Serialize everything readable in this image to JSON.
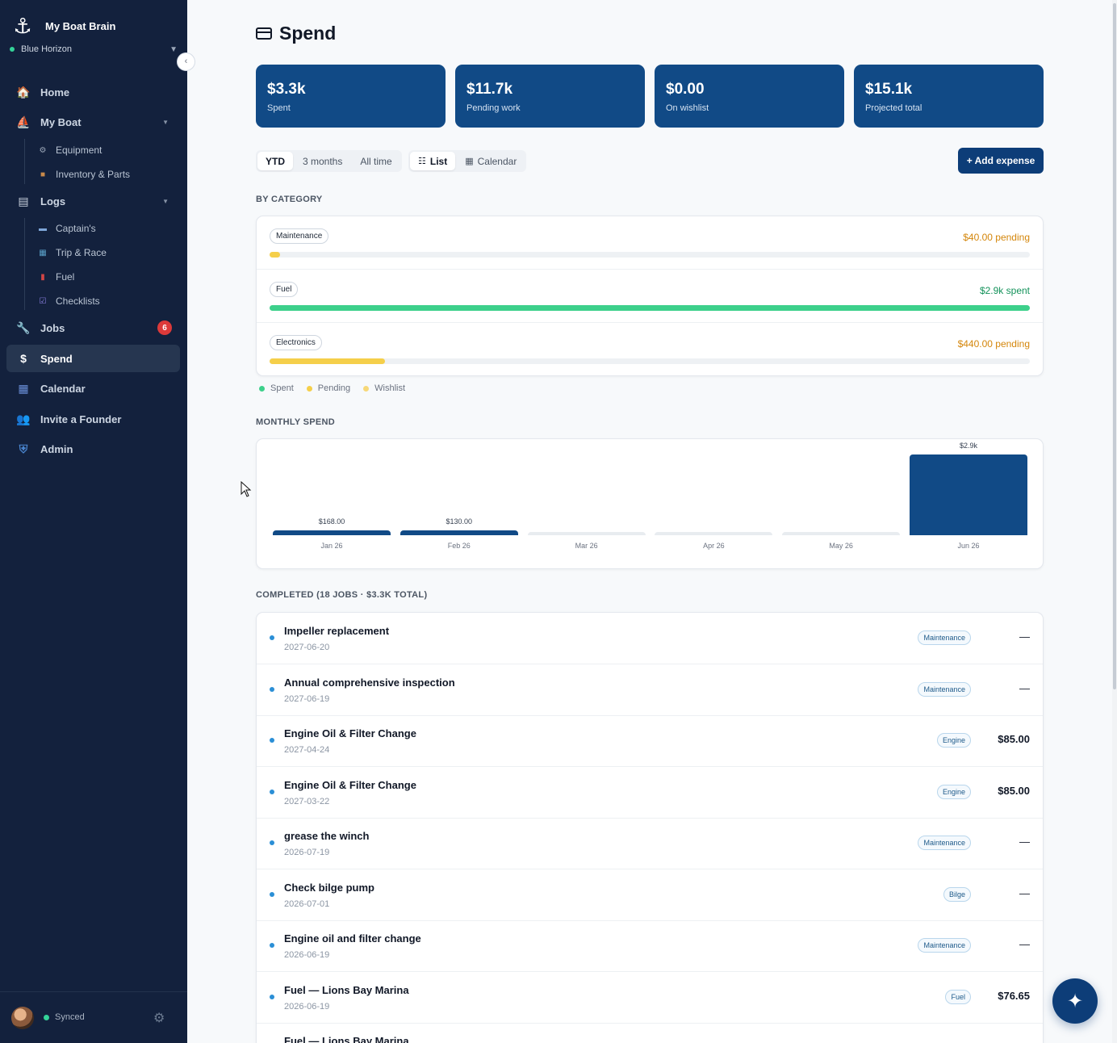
{
  "app": {
    "name": "My Boat Brain",
    "boat": "Blue Horizon"
  },
  "nav": {
    "home": "Home",
    "my_boat": "My Boat",
    "equipment": "Equipment",
    "inventory": "Inventory & Parts",
    "logs": "Logs",
    "captains": "Captain's",
    "trip": "Trip & Race",
    "fuel": "Fuel",
    "checklists": "Checklists",
    "jobs": "Jobs",
    "jobs_badge": "6",
    "spend": "Spend",
    "calendar": "Calendar",
    "invite": "Invite a Founder",
    "admin": "Admin"
  },
  "footer": {
    "status": "Synced"
  },
  "page": {
    "title": "Spend"
  },
  "stats": [
    {
      "value": "$3.3k",
      "label": "Spent"
    },
    {
      "value": "$11.7k",
      "label": "Pending work"
    },
    {
      "value": "$0.00",
      "label": "On wishlist"
    },
    {
      "value": "$15.1k",
      "label": "Projected total"
    }
  ],
  "filters": {
    "ytd": "YTD",
    "three_months": "3 months",
    "all_time": "All time",
    "list": "List",
    "calendar": "Calendar"
  },
  "add_expense": "+ Add expense",
  "by_category": {
    "heading": "BY CATEGORY",
    "items": [
      {
        "name": "Maintenance",
        "value": "$40.00 pending",
        "fraction": 0.014,
        "color": "#f5cf4a",
        "text_color": "#d4860b"
      },
      {
        "name": "Fuel",
        "value": "$2.9k spent",
        "fraction": 1.0,
        "color": "#3dd08b",
        "text_color": "#13925a"
      },
      {
        "name": "Electronics",
        "value": "$440.00 pending",
        "fraction": 0.152,
        "color": "#f5cf4a",
        "text_color": "#d4860b"
      }
    ],
    "legend": [
      {
        "label": "Spent",
        "color": "#3dd08b"
      },
      {
        "label": "Pending",
        "color": "#f5cf4a"
      },
      {
        "label": "Wishlist",
        "color": "#f7d878"
      }
    ]
  },
  "chart_data": {
    "type": "bar",
    "title": "MONTHLY SPEND",
    "categories": [
      "Jan 26",
      "Feb 26",
      "Mar 26",
      "Apr 26",
      "May 26",
      "Jun 26"
    ],
    "values": [
      168,
      130,
      0,
      0,
      0,
      2900
    ],
    "value_labels": [
      "$168.00",
      "$130.00",
      "",
      "",
      "",
      "$2.9k"
    ],
    "ylim": [
      0,
      2900
    ],
    "grid": false,
    "bar_color": "#114a86",
    "empty_color": "#e8ecf0"
  },
  "completed": {
    "heading": "COMPLETED (18 JOBS · $3.3K TOTAL)",
    "jobs": [
      {
        "title": "Impeller replacement",
        "date": "2027-06-20",
        "tag": "Maintenance",
        "amount": "—"
      },
      {
        "title": "Annual comprehensive inspection",
        "date": "2027-06-19",
        "tag": "Maintenance",
        "amount": "—"
      },
      {
        "title": "Engine Oil & Filter Change",
        "date": "2027-04-24",
        "tag": "Engine",
        "amount": "$85.00"
      },
      {
        "title": "Engine Oil & Filter Change",
        "date": "2027-03-22",
        "tag": "Engine",
        "amount": "$85.00"
      },
      {
        "title": "grease the winch",
        "date": "2026-07-19",
        "tag": "Maintenance",
        "amount": "—"
      },
      {
        "title": "Check bilge pump",
        "date": "2026-07-01",
        "tag": "Bilge",
        "amount": "—"
      },
      {
        "title": "Engine oil and filter change",
        "date": "2026-06-19",
        "tag": "Maintenance",
        "amount": "—"
      },
      {
        "title": "Fuel — Lions Bay Marina",
        "date": "2026-06-19",
        "tag": "Fuel",
        "amount": "$76.65"
      },
      {
        "title": "Fuel — Lions Bay Marina",
        "date": "",
        "tag": "",
        "amount": ""
      }
    ]
  }
}
